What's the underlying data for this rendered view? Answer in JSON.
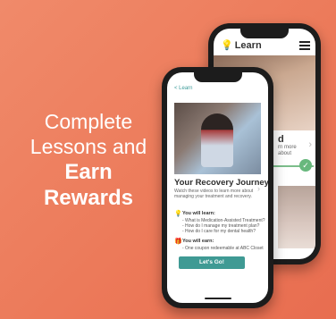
{
  "headline": {
    "line1": "Complete",
    "line2": "Lessons and",
    "line3": "Earn",
    "line4": "Rewards"
  },
  "back_phone": {
    "header_title": "Learn",
    "card_title": "d",
    "card_sub": "rn more about"
  },
  "front_phone": {
    "back_link": "< Learn",
    "title": "Your Recovery Journey",
    "intro": "Watch these videos to learn more about managing your treatment and recovery.",
    "learn_title": "You will learn:",
    "learn_items": [
      "- What is Medication-Assisted Treatment?",
      "- How do I manage my treatment plan?",
      "- How do I care for my dental health?"
    ],
    "earn_title": "You will earn:",
    "earn_items": [
      "- One coupon redeemable at ABC Closet"
    ],
    "cta": "Let's Go!"
  },
  "icons": {
    "bulb": "lightbulb-icon",
    "gift": "gift-icon",
    "menu": "hamburger-icon",
    "check": "checkmark-icon"
  },
  "colors": {
    "background": "#ec7a5a",
    "accent_teal": "#3f9a94",
    "progress_green": "#68b87d",
    "bulb_yellow": "#e6a82a"
  }
}
